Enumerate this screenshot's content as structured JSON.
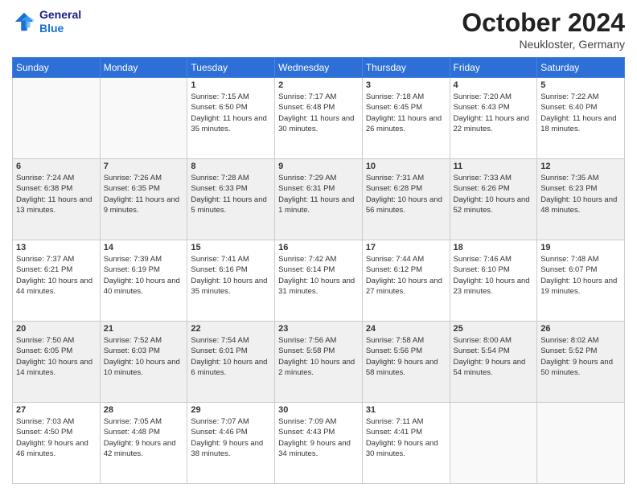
{
  "header": {
    "logo_line1": "General",
    "logo_line2": "Blue",
    "month": "October 2024",
    "location": "Neukloster, Germany"
  },
  "weekdays": [
    "Sunday",
    "Monday",
    "Tuesday",
    "Wednesday",
    "Thursday",
    "Friday",
    "Saturday"
  ],
  "weeks": [
    [
      {
        "day": "",
        "sunrise": "",
        "sunset": "",
        "daylight": ""
      },
      {
        "day": "",
        "sunrise": "",
        "sunset": "",
        "daylight": ""
      },
      {
        "day": "1",
        "sunrise": "Sunrise: 7:15 AM",
        "sunset": "Sunset: 6:50 PM",
        "daylight": "Daylight: 11 hours and 35 minutes."
      },
      {
        "day": "2",
        "sunrise": "Sunrise: 7:17 AM",
        "sunset": "Sunset: 6:48 PM",
        "daylight": "Daylight: 11 hours and 30 minutes."
      },
      {
        "day": "3",
        "sunrise": "Sunrise: 7:18 AM",
        "sunset": "Sunset: 6:45 PM",
        "daylight": "Daylight: 11 hours and 26 minutes."
      },
      {
        "day": "4",
        "sunrise": "Sunrise: 7:20 AM",
        "sunset": "Sunset: 6:43 PM",
        "daylight": "Daylight: 11 hours and 22 minutes."
      },
      {
        "day": "5",
        "sunrise": "Sunrise: 7:22 AM",
        "sunset": "Sunset: 6:40 PM",
        "daylight": "Daylight: 11 hours and 18 minutes."
      }
    ],
    [
      {
        "day": "6",
        "sunrise": "Sunrise: 7:24 AM",
        "sunset": "Sunset: 6:38 PM",
        "daylight": "Daylight: 11 hours and 13 minutes."
      },
      {
        "day": "7",
        "sunrise": "Sunrise: 7:26 AM",
        "sunset": "Sunset: 6:35 PM",
        "daylight": "Daylight: 11 hours and 9 minutes."
      },
      {
        "day": "8",
        "sunrise": "Sunrise: 7:28 AM",
        "sunset": "Sunset: 6:33 PM",
        "daylight": "Daylight: 11 hours and 5 minutes."
      },
      {
        "day": "9",
        "sunrise": "Sunrise: 7:29 AM",
        "sunset": "Sunset: 6:31 PM",
        "daylight": "Daylight: 11 hours and 1 minute."
      },
      {
        "day": "10",
        "sunrise": "Sunrise: 7:31 AM",
        "sunset": "Sunset: 6:28 PM",
        "daylight": "Daylight: 10 hours and 56 minutes."
      },
      {
        "day": "11",
        "sunrise": "Sunrise: 7:33 AM",
        "sunset": "Sunset: 6:26 PM",
        "daylight": "Daylight: 10 hours and 52 minutes."
      },
      {
        "day": "12",
        "sunrise": "Sunrise: 7:35 AM",
        "sunset": "Sunset: 6:23 PM",
        "daylight": "Daylight: 10 hours and 48 minutes."
      }
    ],
    [
      {
        "day": "13",
        "sunrise": "Sunrise: 7:37 AM",
        "sunset": "Sunset: 6:21 PM",
        "daylight": "Daylight: 10 hours and 44 minutes."
      },
      {
        "day": "14",
        "sunrise": "Sunrise: 7:39 AM",
        "sunset": "Sunset: 6:19 PM",
        "daylight": "Daylight: 10 hours and 40 minutes."
      },
      {
        "day": "15",
        "sunrise": "Sunrise: 7:41 AM",
        "sunset": "Sunset: 6:16 PM",
        "daylight": "Daylight: 10 hours and 35 minutes."
      },
      {
        "day": "16",
        "sunrise": "Sunrise: 7:42 AM",
        "sunset": "Sunset: 6:14 PM",
        "daylight": "Daylight: 10 hours and 31 minutes."
      },
      {
        "day": "17",
        "sunrise": "Sunrise: 7:44 AM",
        "sunset": "Sunset: 6:12 PM",
        "daylight": "Daylight: 10 hours and 27 minutes."
      },
      {
        "day": "18",
        "sunrise": "Sunrise: 7:46 AM",
        "sunset": "Sunset: 6:10 PM",
        "daylight": "Daylight: 10 hours and 23 minutes."
      },
      {
        "day": "19",
        "sunrise": "Sunrise: 7:48 AM",
        "sunset": "Sunset: 6:07 PM",
        "daylight": "Daylight: 10 hours and 19 minutes."
      }
    ],
    [
      {
        "day": "20",
        "sunrise": "Sunrise: 7:50 AM",
        "sunset": "Sunset: 6:05 PM",
        "daylight": "Daylight: 10 hours and 14 minutes."
      },
      {
        "day": "21",
        "sunrise": "Sunrise: 7:52 AM",
        "sunset": "Sunset: 6:03 PM",
        "daylight": "Daylight: 10 hours and 10 minutes."
      },
      {
        "day": "22",
        "sunrise": "Sunrise: 7:54 AM",
        "sunset": "Sunset: 6:01 PM",
        "daylight": "Daylight: 10 hours and 6 minutes."
      },
      {
        "day": "23",
        "sunrise": "Sunrise: 7:56 AM",
        "sunset": "Sunset: 5:58 PM",
        "daylight": "Daylight: 10 hours and 2 minutes."
      },
      {
        "day": "24",
        "sunrise": "Sunrise: 7:58 AM",
        "sunset": "Sunset: 5:56 PM",
        "daylight": "Daylight: 9 hours and 58 minutes."
      },
      {
        "day": "25",
        "sunrise": "Sunrise: 8:00 AM",
        "sunset": "Sunset: 5:54 PM",
        "daylight": "Daylight: 9 hours and 54 minutes."
      },
      {
        "day": "26",
        "sunrise": "Sunrise: 8:02 AM",
        "sunset": "Sunset: 5:52 PM",
        "daylight": "Daylight: 9 hours and 50 minutes."
      }
    ],
    [
      {
        "day": "27",
        "sunrise": "Sunrise: 7:03 AM",
        "sunset": "Sunset: 4:50 PM",
        "daylight": "Daylight: 9 hours and 46 minutes."
      },
      {
        "day": "28",
        "sunrise": "Sunrise: 7:05 AM",
        "sunset": "Sunset: 4:48 PM",
        "daylight": "Daylight: 9 hours and 42 minutes."
      },
      {
        "day": "29",
        "sunrise": "Sunrise: 7:07 AM",
        "sunset": "Sunset: 4:46 PM",
        "daylight": "Daylight: 9 hours and 38 minutes."
      },
      {
        "day": "30",
        "sunrise": "Sunrise: 7:09 AM",
        "sunset": "Sunset: 4:43 PM",
        "daylight": "Daylight: 9 hours and 34 minutes."
      },
      {
        "day": "31",
        "sunrise": "Sunrise: 7:11 AM",
        "sunset": "Sunset: 4:41 PM",
        "daylight": "Daylight: 9 hours and 30 minutes."
      },
      {
        "day": "",
        "sunrise": "",
        "sunset": "",
        "daylight": ""
      },
      {
        "day": "",
        "sunrise": "",
        "sunset": "",
        "daylight": ""
      }
    ]
  ]
}
